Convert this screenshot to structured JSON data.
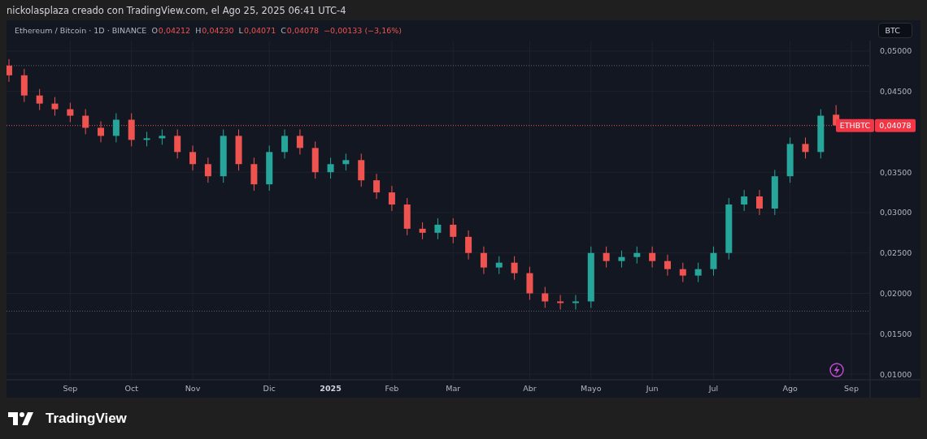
{
  "credit": "nickolasplaza creado con TradingView.com, el Ago 25, 2025 06:41 UTC-4",
  "header": {
    "symbol": "Ethereum / Bitcoin · 1D · BINANCE",
    "ohlc": [
      {
        "label": "O",
        "value": "0,04212"
      },
      {
        "label": "H",
        "value": "0,04230"
      },
      {
        "label": "L",
        "value": "0,04071"
      },
      {
        "label": "C",
        "value": "0,04078"
      }
    ],
    "change": "−0,00133 (−3,16%)",
    "currency_button": "BTC"
  },
  "chart": {
    "symbol_badge": "ETHBTC",
    "price_badge": "0,04078",
    "chart_data": {
      "type": "candlestick",
      "ylim": [
        0.0093,
        0.0513
      ],
      "grid": true,
      "ref_lines": [
        {
          "axis": "y",
          "value": 0.0482,
          "color": "#5d606b"
        },
        {
          "axis": "y",
          "value": 0.0178,
          "color": "#5d606b"
        },
        {
          "axis": "y",
          "value": 0.04078,
          "color": "#ef5350"
        }
      ],
      "categories": [
        null,
        null,
        null,
        null,
        "Sep",
        null,
        null,
        null,
        "Oct",
        null,
        null,
        null,
        "Nov",
        null,
        null,
        null,
        null,
        "Dic",
        null,
        null,
        null,
        "2025",
        null,
        null,
        null,
        "Feb",
        null,
        null,
        null,
        "Mar",
        null,
        null,
        null,
        null,
        "Abr",
        null,
        null,
        null,
        "Mayo",
        null,
        null,
        null,
        "Jun",
        null,
        null,
        null,
        "Jul",
        null,
        null,
        null,
        null,
        "Ago",
        null,
        null,
        null,
        "Sep"
      ],
      "ohlc": [
        [
          0.0482,
          0.049,
          0.0462,
          0.047
        ],
        [
          0.047,
          0.0478,
          0.0437,
          0.0445
        ],
        [
          0.0445,
          0.0453,
          0.0427,
          0.0435
        ],
        [
          0.0435,
          0.0443,
          0.042,
          0.0428
        ],
        [
          0.0428,
          0.0436,
          0.0412,
          0.042
        ],
        [
          0.042,
          0.0428,
          0.0397,
          0.0405
        ],
        [
          0.0405,
          0.0413,
          0.0387,
          0.0395
        ],
        [
          0.0395,
          0.0423,
          0.0387,
          0.0415
        ],
        [
          0.0415,
          0.0423,
          0.0382,
          0.039
        ],
        [
          0.039,
          0.04,
          0.0382,
          0.0392
        ],
        [
          0.0392,
          0.0403,
          0.0384,
          0.0395
        ],
        [
          0.0395,
          0.0403,
          0.0367,
          0.0375
        ],
        [
          0.0375,
          0.0383,
          0.0352,
          0.036
        ],
        [
          0.036,
          0.0368,
          0.0337,
          0.0345
        ],
        [
          0.0345,
          0.0403,
          0.0337,
          0.0395
        ],
        [
          0.0395,
          0.0403,
          0.0352,
          0.036
        ],
        [
          0.036,
          0.0368,
          0.0327,
          0.0335
        ],
        [
          0.0335,
          0.0383,
          0.0327,
          0.0375
        ],
        [
          0.0375,
          0.0403,
          0.0367,
          0.0395
        ],
        [
          0.0395,
          0.0403,
          0.0372,
          0.038
        ],
        [
          0.038,
          0.0388,
          0.0342,
          0.035
        ],
        [
          0.035,
          0.0368,
          0.0342,
          0.036
        ],
        [
          0.036,
          0.0373,
          0.0352,
          0.0365
        ],
        [
          0.0365,
          0.0373,
          0.0332,
          0.034
        ],
        [
          0.034,
          0.0348,
          0.0317,
          0.0325
        ],
        [
          0.0325,
          0.0333,
          0.0302,
          0.031
        ],
        [
          0.031,
          0.0318,
          0.0272,
          0.028
        ],
        [
          0.028,
          0.0288,
          0.0267,
          0.0275
        ],
        [
          0.0275,
          0.0293,
          0.0267,
          0.0285
        ],
        [
          0.0285,
          0.0293,
          0.0262,
          0.027
        ],
        [
          0.027,
          0.0278,
          0.0242,
          0.025
        ],
        [
          0.025,
          0.0258,
          0.0224,
          0.0232
        ],
        [
          0.0232,
          0.0246,
          0.0224,
          0.0238
        ],
        [
          0.0238,
          0.0246,
          0.0217,
          0.0225
        ],
        [
          0.0225,
          0.0233,
          0.0192,
          0.02
        ],
        [
          0.02,
          0.0208,
          0.0182,
          0.019
        ],
        [
          0.019,
          0.0198,
          0.018,
          0.0188
        ],
        [
          0.0188,
          0.0198,
          0.018,
          0.019
        ],
        [
          0.019,
          0.0258,
          0.0182,
          0.025
        ],
        [
          0.025,
          0.0258,
          0.0232,
          0.024
        ],
        [
          0.024,
          0.0253,
          0.0232,
          0.0245
        ],
        [
          0.0245,
          0.0258,
          0.0237,
          0.025
        ],
        [
          0.025,
          0.0258,
          0.0232,
          0.024
        ],
        [
          0.024,
          0.0248,
          0.0222,
          0.023
        ],
        [
          0.023,
          0.0238,
          0.0214,
          0.0222
        ],
        [
          0.0222,
          0.0238,
          0.0214,
          0.023
        ],
        [
          0.023,
          0.0258,
          0.0222,
          0.025
        ],
        [
          0.025,
          0.0318,
          0.0242,
          0.031
        ],
        [
          0.031,
          0.0328,
          0.0302,
          0.032
        ],
        [
          0.032,
          0.0328,
          0.0297,
          0.0305
        ],
        [
          0.0305,
          0.0353,
          0.0297,
          0.0345
        ],
        [
          0.0345,
          0.0393,
          0.0337,
          0.0385
        ],
        [
          0.0385,
          0.0393,
          0.0367,
          0.0375
        ],
        [
          0.0375,
          0.0428,
          0.0367,
          0.042
        ],
        [
          0.04212,
          0.0433,
          0.04071,
          0.04078
        ],
        null
      ],
      "yticks": [
        {
          "value": 0.05,
          "label": "0,05000"
        },
        {
          "value": 0.045,
          "label": "0,04500"
        },
        {
          "value": 0.035,
          "label": "0,03500"
        },
        {
          "value": 0.03,
          "label": "0,03000"
        },
        {
          "value": 0.025,
          "label": "0,02500"
        },
        {
          "value": 0.02,
          "label": "0,02000"
        },
        {
          "value": 0.015,
          "label": "0,01500"
        },
        {
          "value": 0.01,
          "label": "0,01000"
        }
      ]
    }
  },
  "footer": {
    "brand": "TradingView"
  }
}
